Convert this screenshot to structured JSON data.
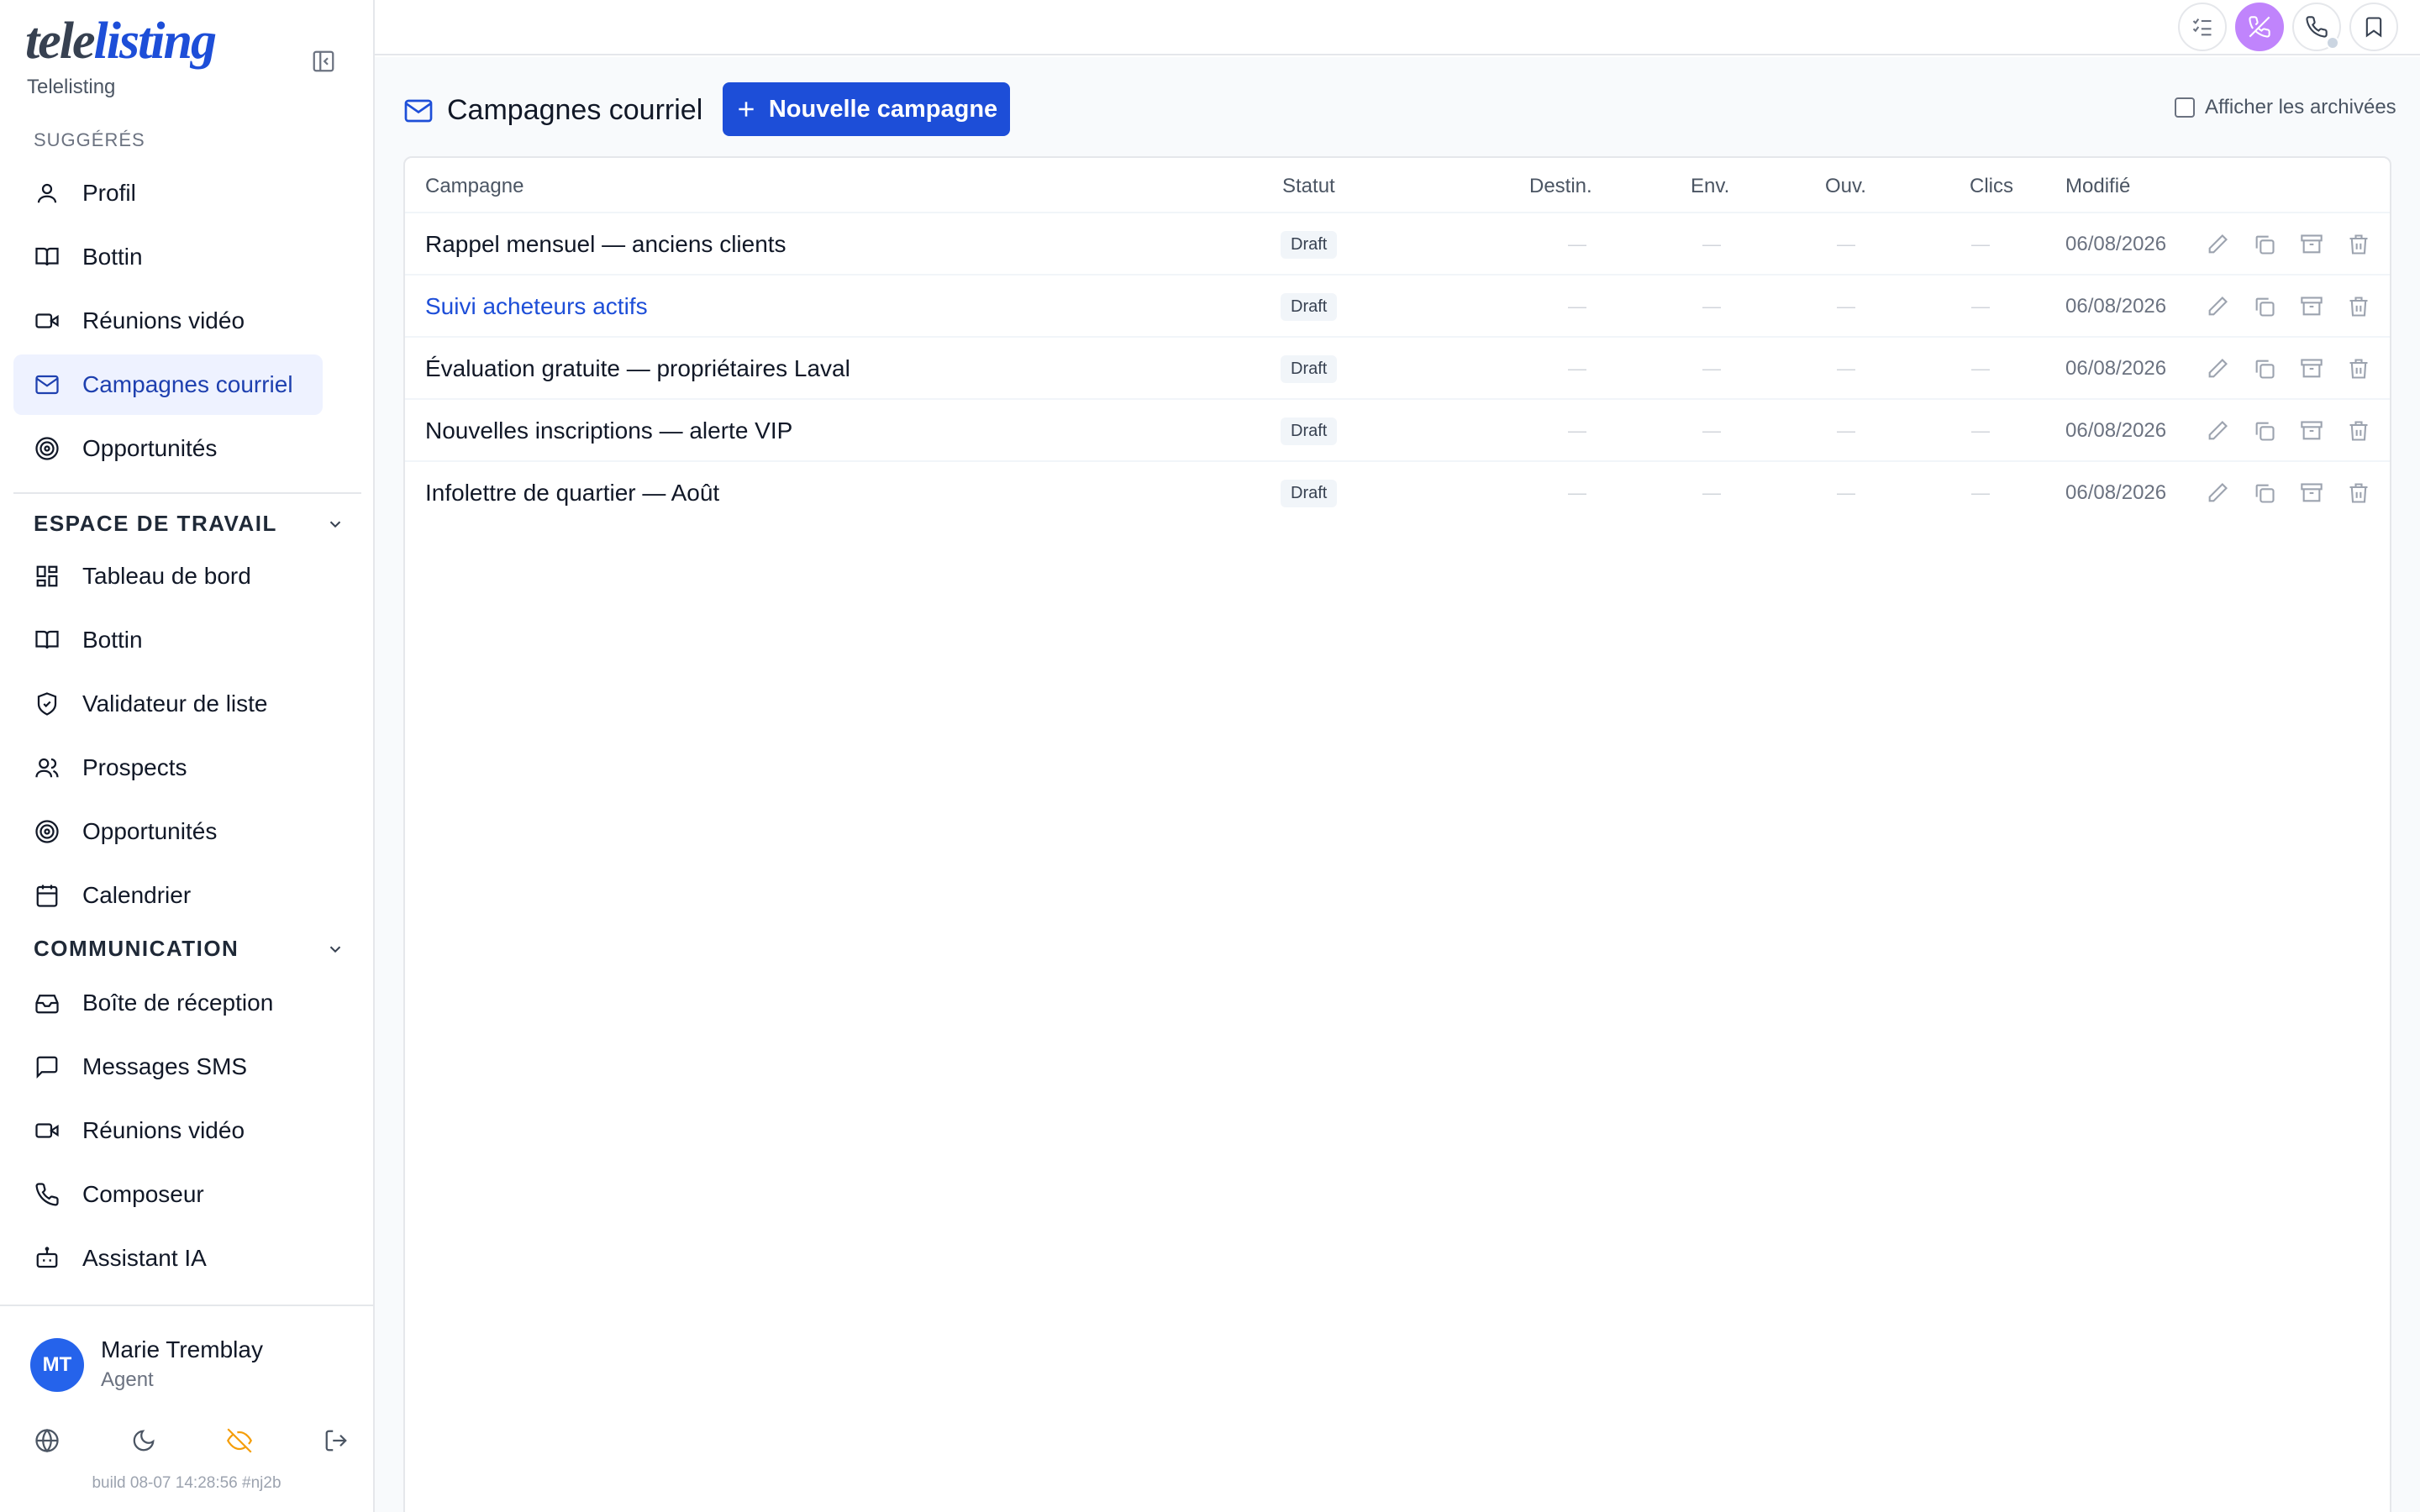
{
  "brand": {
    "logo_tele": "tele",
    "logo_listing": "listing",
    "subtitle": "Telelisting"
  },
  "sidebar": {
    "suggested_label": "SUGGÉRÉS",
    "suggested": [
      {
        "label": "Profil",
        "icon": "user-icon"
      },
      {
        "label": "Bottin",
        "icon": "book-icon"
      },
      {
        "label": "Réunions vidéo",
        "icon": "video-icon"
      },
      {
        "label": "Campagnes courriel",
        "icon": "mail-icon",
        "active": true
      },
      {
        "label": "Opportunités",
        "icon": "target-icon"
      }
    ],
    "workspace_label": "ESPACE DE TRAVAIL",
    "workspace": [
      {
        "label": "Tableau de bord",
        "icon": "dashboard-icon"
      },
      {
        "label": "Bottin",
        "icon": "book-icon"
      },
      {
        "label": "Validateur de liste",
        "icon": "shield-check-icon"
      },
      {
        "label": "Prospects",
        "icon": "users-icon"
      },
      {
        "label": "Opportunités",
        "icon": "target-icon"
      },
      {
        "label": "Calendrier",
        "icon": "calendar-icon"
      }
    ],
    "communication_label": "COMMUNICATION",
    "communication": [
      {
        "label": "Boîte de réception",
        "icon": "inbox-icon"
      },
      {
        "label": "Messages SMS",
        "icon": "message-icon"
      },
      {
        "label": "Réunions vidéo",
        "icon": "video-icon"
      },
      {
        "label": "Composeur",
        "icon": "phone-icon"
      },
      {
        "label": "Assistant IA",
        "icon": "bot-icon"
      }
    ]
  },
  "user": {
    "initials": "MT",
    "name": "Marie Tremblay",
    "role": "Agent",
    "build": "build 08-07 14:28:56 #nj2b"
  },
  "footer_icons": [
    "globe-icon",
    "moon-icon",
    "eye-off-icon",
    "logout-icon"
  ],
  "topbar_icons": [
    "checklist-icon",
    "phone-off-icon",
    "phone-icon",
    "bookmark-icon"
  ],
  "page": {
    "title": "Campagnes courriel",
    "new_button": "Nouvelle campagne",
    "archive_toggle": "Afficher les archivées"
  },
  "table": {
    "headers": {
      "campaign": "Campagne",
      "status": "Statut",
      "recipients": "Destin.",
      "sent": "Env.",
      "opened": "Ouv.",
      "clicks": "Clics",
      "modified": "Modifié"
    },
    "rows": [
      {
        "name": "Rappel mensuel — anciens clients",
        "status": "Draft",
        "recipients": "—",
        "sent": "—",
        "opened": "—",
        "clicks": "—",
        "modified": "06/08/2026"
      },
      {
        "name": "Suivi acheteurs actifs",
        "status": "Draft",
        "recipients": "—",
        "sent": "—",
        "opened": "—",
        "clicks": "—",
        "modified": "06/08/2026"
      },
      {
        "name": "Évaluation gratuite — propriétaires Laval",
        "status": "Draft",
        "recipients": "—",
        "sent": "—",
        "opened": "—",
        "clicks": "—",
        "modified": "06/08/2026"
      },
      {
        "name": "Nouvelles inscriptions — alerte VIP",
        "status": "Draft",
        "recipients": "—",
        "sent": "—",
        "opened": "—",
        "clicks": "—",
        "modified": "06/08/2026"
      },
      {
        "name": "Infolettre de quartier — Août",
        "status": "Draft",
        "recipients": "—",
        "sent": "—",
        "opened": "—",
        "clicks": "—",
        "modified": "06/08/2026"
      }
    ]
  },
  "colors": {
    "accent": "#1d4ed8",
    "active_bg": "#eef2ff",
    "warning_icon": "#f59e0b",
    "purple": "#c084fc"
  }
}
